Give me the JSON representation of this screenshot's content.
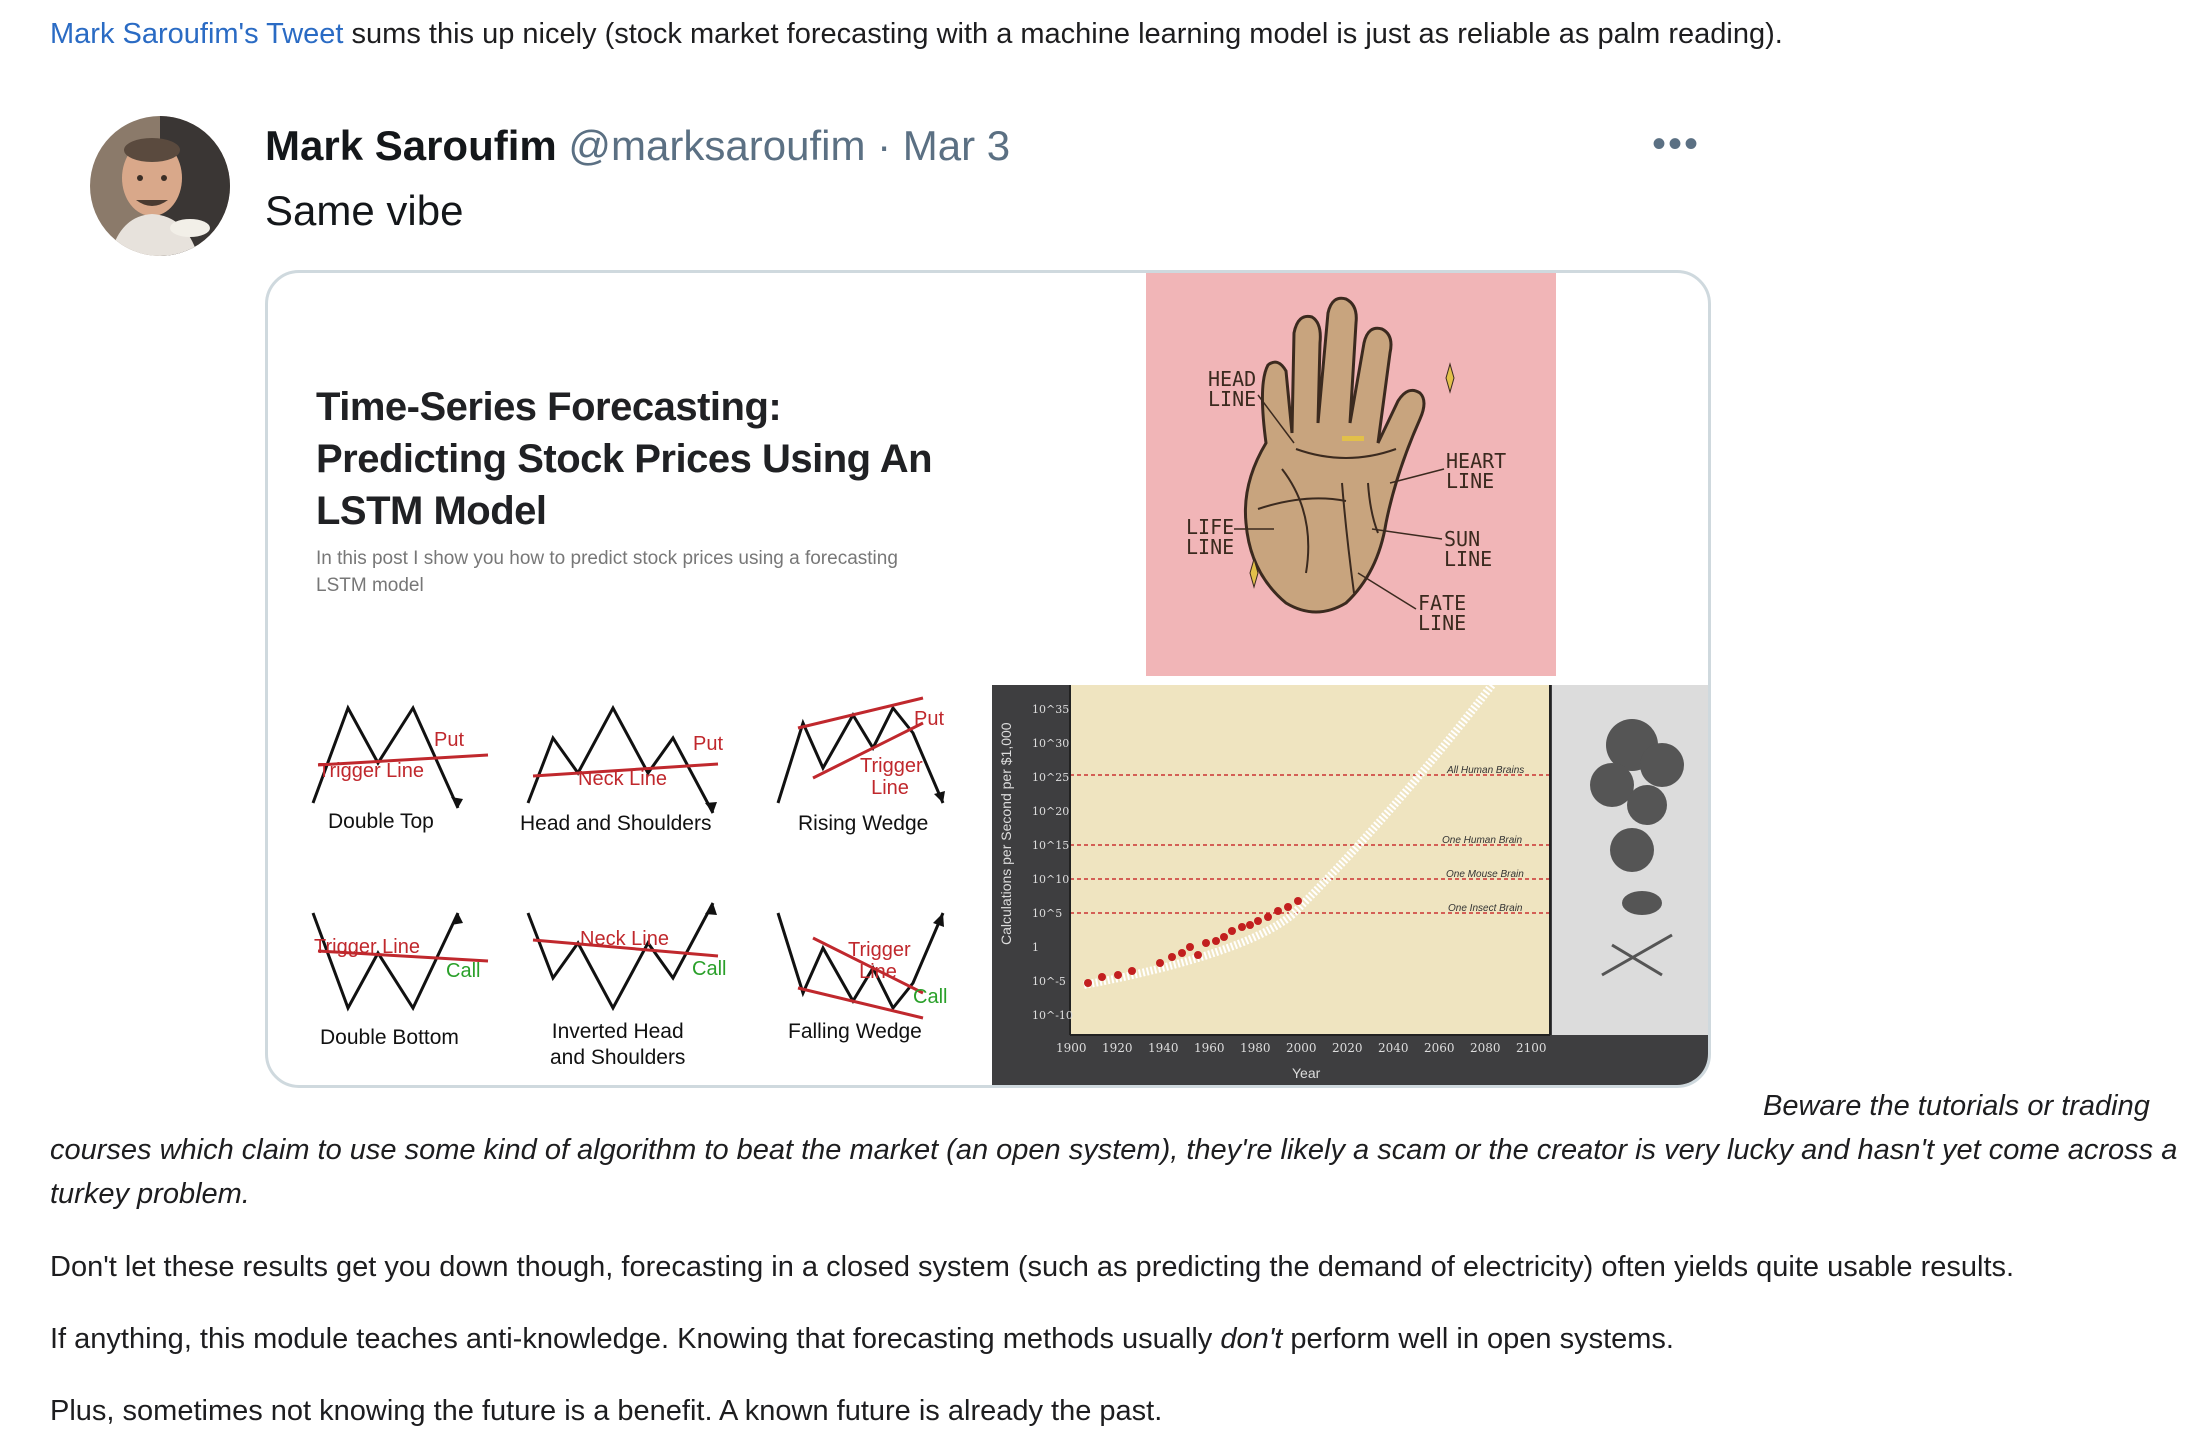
{
  "intro": {
    "link_text": "Mark Saroufim's Tweet",
    "rest": " sums this up nicely (stock market forecasting with a machine learning model is just as reliable as palm reading)."
  },
  "tweet": {
    "name": "Mark Saroufim",
    "handle": "@marksaroufim",
    "separator": " · ",
    "date": "Mar 3",
    "text": "Same vibe",
    "more_icon": "more-horizontal-icon"
  },
  "card": {
    "title_lines": [
      "Time-Series Forecasting:",
      "Predicting Stock Prices Using An",
      "LSTM Model"
    ],
    "subtitle_lines": [
      "In this post I show you how to predict stock prices using a forecasting",
      "LSTM model"
    ],
    "patterns": [
      {
        "label": "Double Top",
        "line_label": "Trigger Line",
        "signal": "Put"
      },
      {
        "label": "Head and Shoulders",
        "line_label": "Neck Line",
        "signal": "Put"
      },
      {
        "label": "Rising Wedge",
        "line_label": "Trigger Line",
        "signal": "Put"
      },
      {
        "label": "Double Bottom",
        "line_label": "Trigger Line",
        "signal": "Call"
      },
      {
        "label": "Inverted Head and Shoulders",
        "label_lines": [
          "Inverted Head",
          "and Shoulders"
        ],
        "line_label": "Neck Line",
        "signal": "Call"
      },
      {
        "label": "Falling Wedge",
        "line_label": "Trigger Line",
        "signal": "Call"
      }
    ],
    "palm": {
      "labels": {
        "head": [
          "HEAD",
          "LINE"
        ],
        "heart": [
          "HEART",
          "LINE"
        ],
        "life": [
          "LIFE",
          "LINE"
        ],
        "sun": [
          "SUN",
          "LINE"
        ],
        "fate": [
          "FATE",
          "LINE"
        ]
      },
      "bg_color": "#f1b5b7",
      "hand_color": "#c8a47e"
    },
    "chart": {
      "ylabel": "Calculations per Second per $1,000",
      "xlabel": "Year",
      "x_ticks": [
        "1900",
        "1920",
        "1940",
        "1960",
        "1980",
        "2000",
        "2020",
        "2040",
        "2060",
        "2080",
        "2100"
      ],
      "y_ticks": [
        "10^35",
        "10^30",
        "10^25",
        "10^20",
        "10^15",
        "10^10",
        "10^5",
        "1",
        "10^-5",
        "10^-10"
      ],
      "levels": [
        "All Human Brains",
        "One Human Brain",
        "One Mouse Brain",
        "One Insect Brain"
      ]
    }
  },
  "body": {
    "beware_line1": "Beware the tutorials or trading",
    "beware_rest": "courses which claim to use some kind of algorithm to beat the market (an open system), they're likely a scam or the creator is very lucky and hasn't yet come across a turkey problem.",
    "p1": "Don't let these results get you down though, forecasting in a closed system (such as predicting the demand of electricity) often yields quite usable results.",
    "p2_before": "If anything, this module teaches anti-knowledge. Knowing that forecasting methods usually ",
    "p2_em": "don't",
    "p2_after": " perform well in open systems.",
    "p3": "Plus, sometimes not knowing the future is a benefit. A known future is already the past."
  }
}
